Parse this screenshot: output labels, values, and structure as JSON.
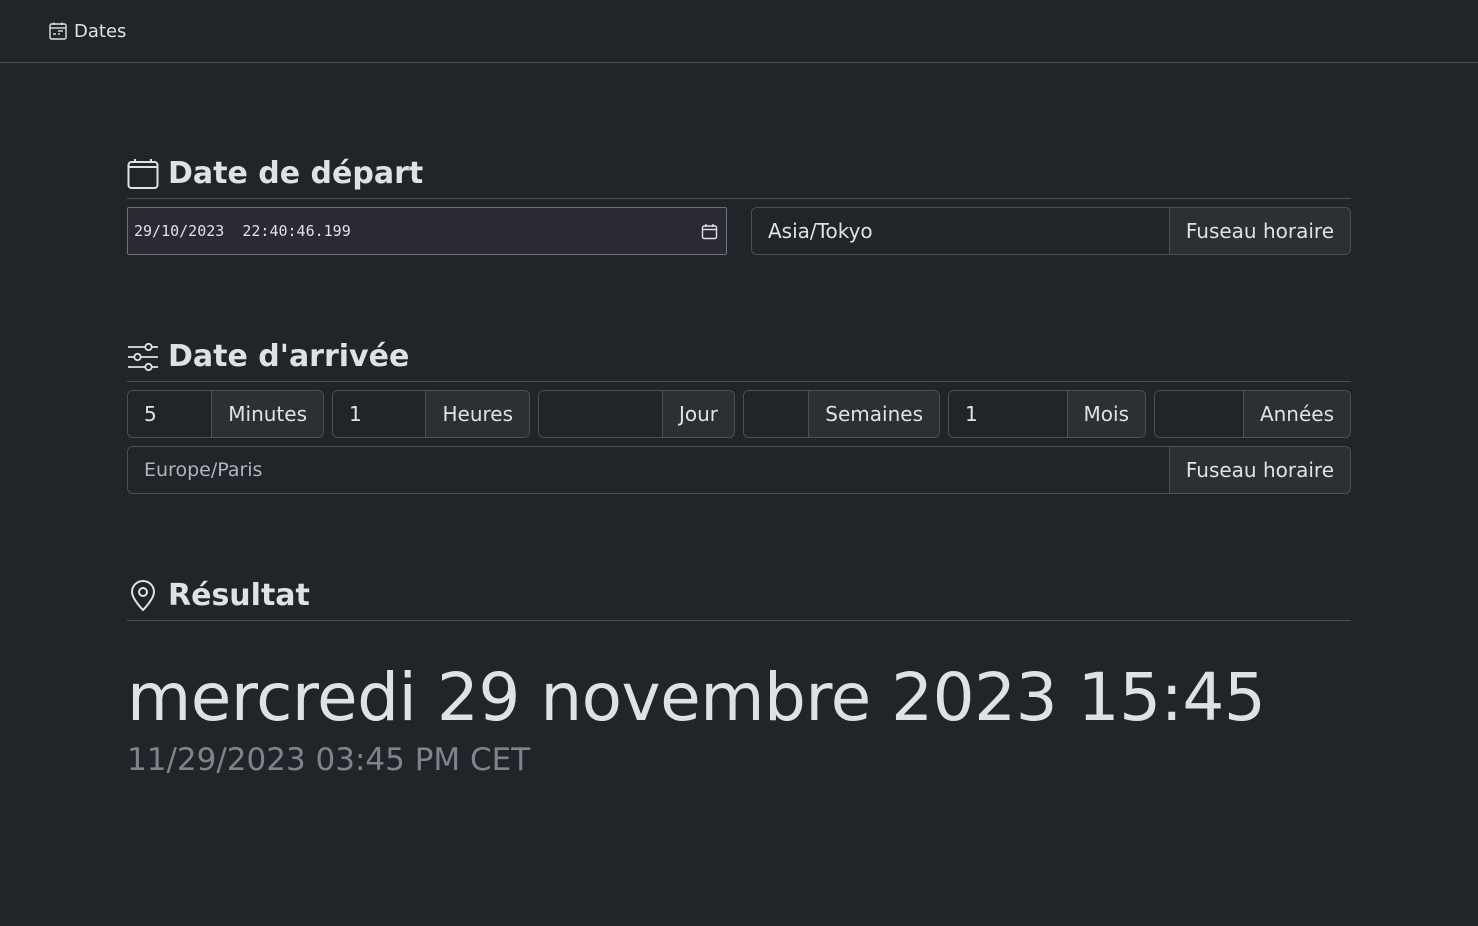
{
  "navbar": {
    "brand": "Dates",
    "brand_icon": "calendar-week-icon"
  },
  "departure": {
    "title": "Date de départ",
    "icon": "calendar-icon",
    "datetime_value": "29/10/2023  22:40:46.199",
    "timezone_value": "Asia/Tokyo",
    "timezone_label": "Fuseau horaire"
  },
  "arrival": {
    "title": "Date d'arrivée",
    "icon": "sliders-icon",
    "durations": [
      {
        "value": "5",
        "label": "Minutes"
      },
      {
        "value": "1",
        "label": "Heures"
      },
      {
        "value": "",
        "label": "Jour"
      },
      {
        "value": "",
        "label": "Semaines"
      },
      {
        "value": "1",
        "label": "Mois"
      },
      {
        "value": "",
        "label": "Années"
      }
    ],
    "timezone_placeholder": "Europe/Paris",
    "timezone_label": "Fuseau horaire"
  },
  "result": {
    "title": "Résultat",
    "icon": "geo-pin-icon",
    "long": "mercredi 29 novembre 2023 15:45",
    "short": "11/29/2023 03:45 PM CET"
  }
}
